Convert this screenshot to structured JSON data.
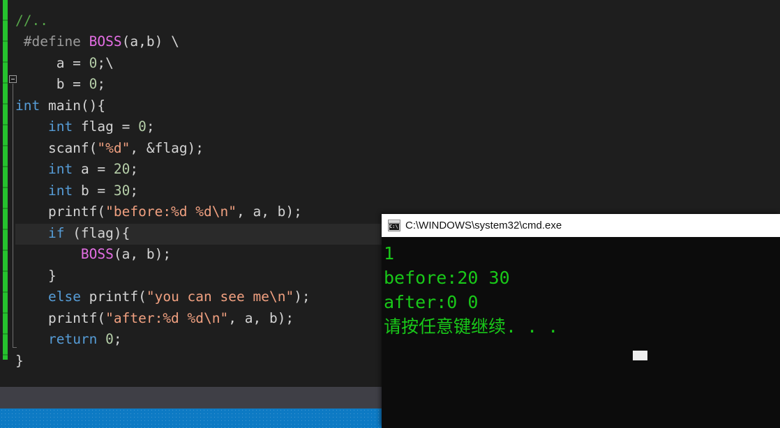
{
  "app": {
    "name": "visual-studio-code-editor",
    "background_color": "#1e1e1e"
  },
  "editor": {
    "language": "C",
    "current_line_number": 11,
    "change_track_color": "#26c22e",
    "fold_marker": "collapse-box",
    "lines": [
      {
        "id": "l0",
        "text": "//..",
        "partial_top": true
      },
      {
        "id": "l1",
        "text": "#define BOSS(a,b) \\"
      },
      {
        "id": "l2",
        "text": "    a = 0;\\"
      },
      {
        "id": "l3",
        "text": "    b = 0;"
      },
      {
        "id": "l4",
        "text": "int main(){"
      },
      {
        "id": "l5",
        "text": "    int flag = 0;"
      },
      {
        "id": "l6",
        "text": "    scanf(\"%d\", &flag);"
      },
      {
        "id": "l7",
        "text": "    int a = 20;"
      },
      {
        "id": "l8",
        "text": "    int b = 30;"
      },
      {
        "id": "l9",
        "text": "    printf(\"before:%d %d\\n\", a, b);"
      },
      {
        "id": "l10",
        "text": "    if (flag){"
      },
      {
        "id": "l11",
        "text": "        BOSS(a, b);",
        "highlighted": true
      },
      {
        "id": "l12",
        "text": "    }"
      },
      {
        "id": "l13",
        "text": "    else printf(\"you can see me\\n\");"
      },
      {
        "id": "l14",
        "text": "    printf(\"after:%d %d\\n\", a, b);"
      },
      {
        "id": "l15",
        "text": "    return 0;"
      },
      {
        "id": "l16",
        "text": "}"
      }
    ],
    "token_colors": {
      "comment": "#57a64a",
      "preprocessor": "#9b9b9b",
      "macro": "#e36ee3",
      "keyword": "#569cd6",
      "number": "#b5cea8",
      "string": "#f0a080",
      "plain": "#d4d4d4"
    }
  },
  "status_bar": {
    "color": "#0d7ac4"
  },
  "console": {
    "title": "C:\\WINDOWS\\system32\\cmd.exe",
    "icon": "cmd-icon",
    "icon_label": "C:\\.",
    "text_color": "#19c819",
    "background_color": "#0c0c0c",
    "output": [
      "1",
      "before:20 30",
      "after:0 0",
      "请按任意键继续. . ."
    ],
    "cursor": "block"
  }
}
